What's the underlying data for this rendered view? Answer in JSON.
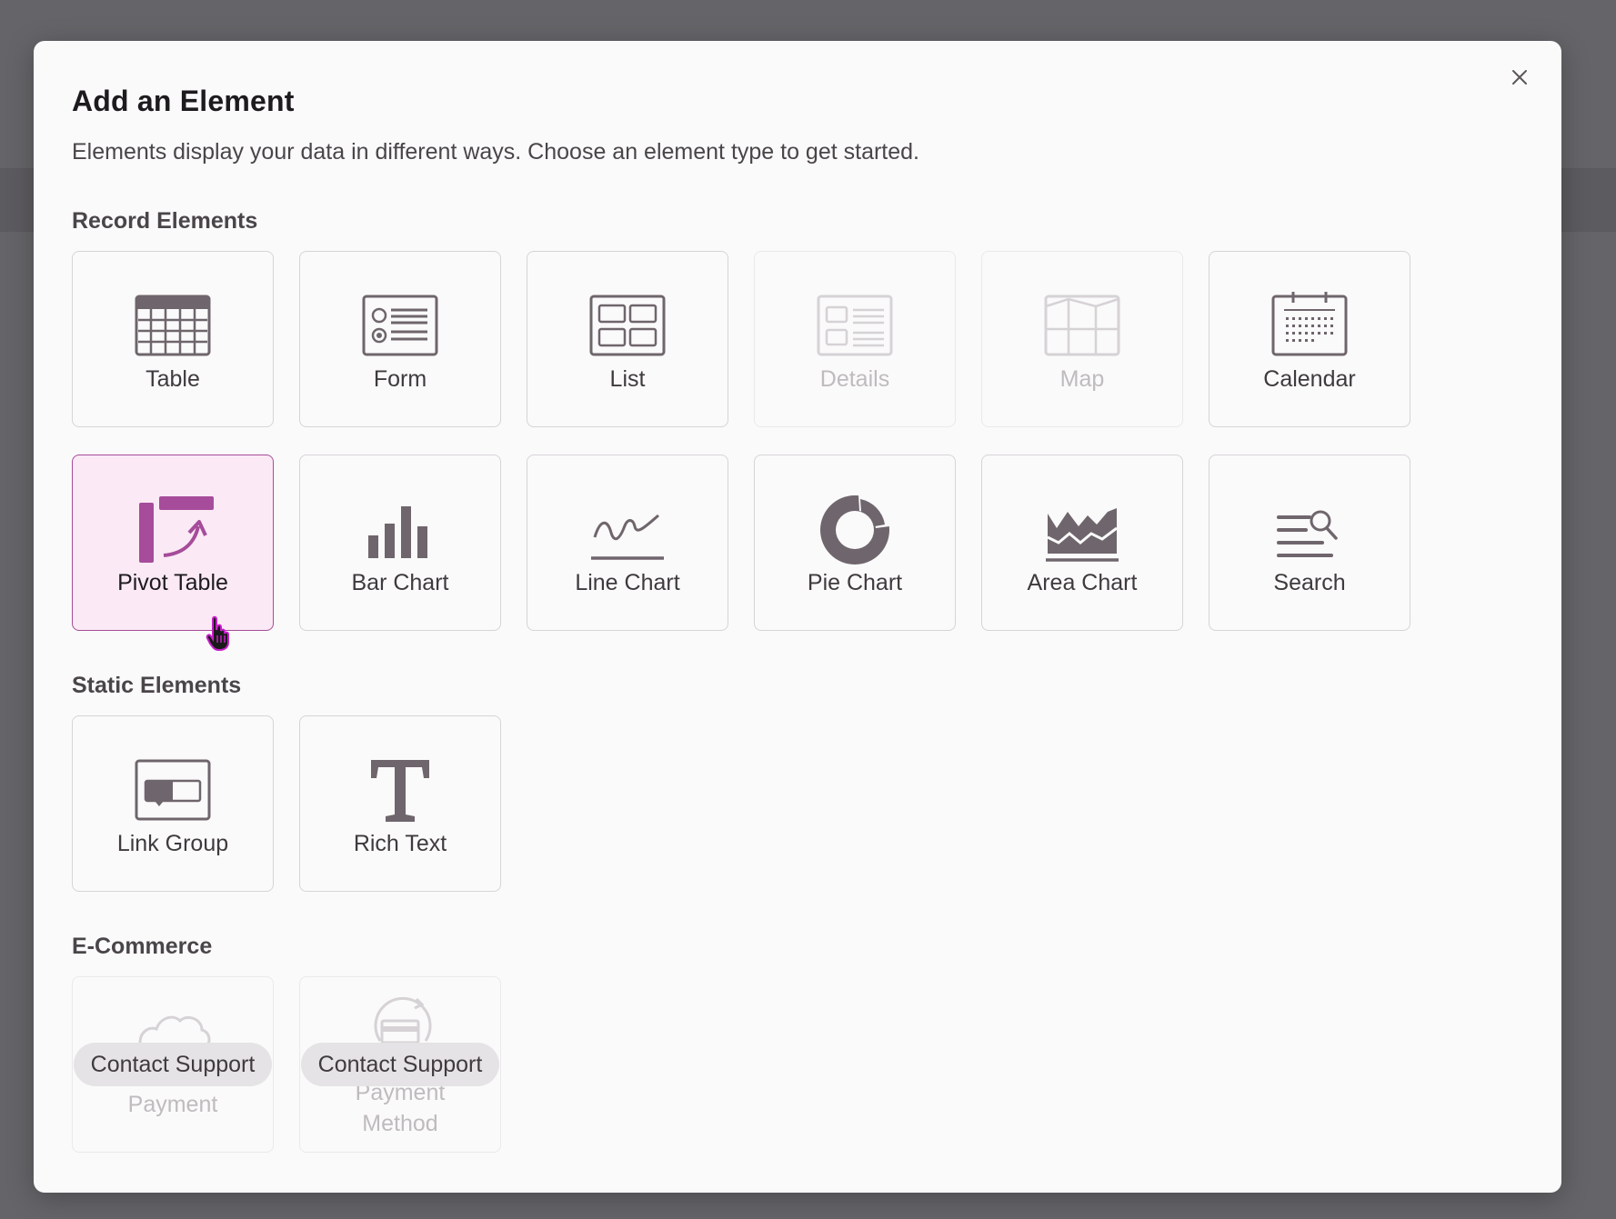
{
  "modal": {
    "title": "Add an Element",
    "subtitle": "Elements display your data in different ways. Choose an element type to get started.",
    "close_icon": "close-icon"
  },
  "colors": {
    "accent": "#a64c9a",
    "icon": "#6f656c",
    "selected_bg": "#fbeaf5",
    "backdrop": "#656468"
  },
  "sections": {
    "record": {
      "label": "Record Elements",
      "items": [
        {
          "label": "Table",
          "icon": "table-icon",
          "state": "enabled"
        },
        {
          "label": "Form",
          "icon": "form-icon",
          "state": "enabled"
        },
        {
          "label": "List",
          "icon": "list-icon",
          "state": "enabled"
        },
        {
          "label": "Details",
          "icon": "details-icon",
          "state": "disabled"
        },
        {
          "label": "Map",
          "icon": "map-icon",
          "state": "disabled"
        },
        {
          "label": "Calendar",
          "icon": "calendar-icon",
          "state": "enabled"
        },
        {
          "label": "Pivot Table",
          "icon": "pivot-table-icon",
          "state": "selected"
        },
        {
          "label": "Bar Chart",
          "icon": "bar-chart-icon",
          "state": "enabled"
        },
        {
          "label": "Line Chart",
          "icon": "line-chart-icon",
          "state": "enabled"
        },
        {
          "label": "Pie Chart",
          "icon": "pie-chart-icon",
          "state": "enabled"
        },
        {
          "label": "Area Chart",
          "icon": "area-chart-icon",
          "state": "enabled"
        },
        {
          "label": "Search",
          "icon": "search-icon",
          "state": "enabled"
        }
      ]
    },
    "static": {
      "label": "Static Elements",
      "items": [
        {
          "label": "Link Group",
          "icon": "link-group-icon",
          "state": "enabled"
        },
        {
          "label": "Rich Text",
          "icon": "rich-text-icon",
          "state": "enabled"
        }
      ]
    },
    "ecommerce": {
      "label": "E-Commerce",
      "items": [
        {
          "label": "Payment",
          "icon": "cloud-icon",
          "state": "locked",
          "badge": "Contact Support"
        },
        {
          "label_line1": "Payment",
          "label_line2": "Method",
          "icon": "payment-method-icon",
          "state": "locked",
          "badge": "Contact Support"
        }
      ]
    }
  }
}
